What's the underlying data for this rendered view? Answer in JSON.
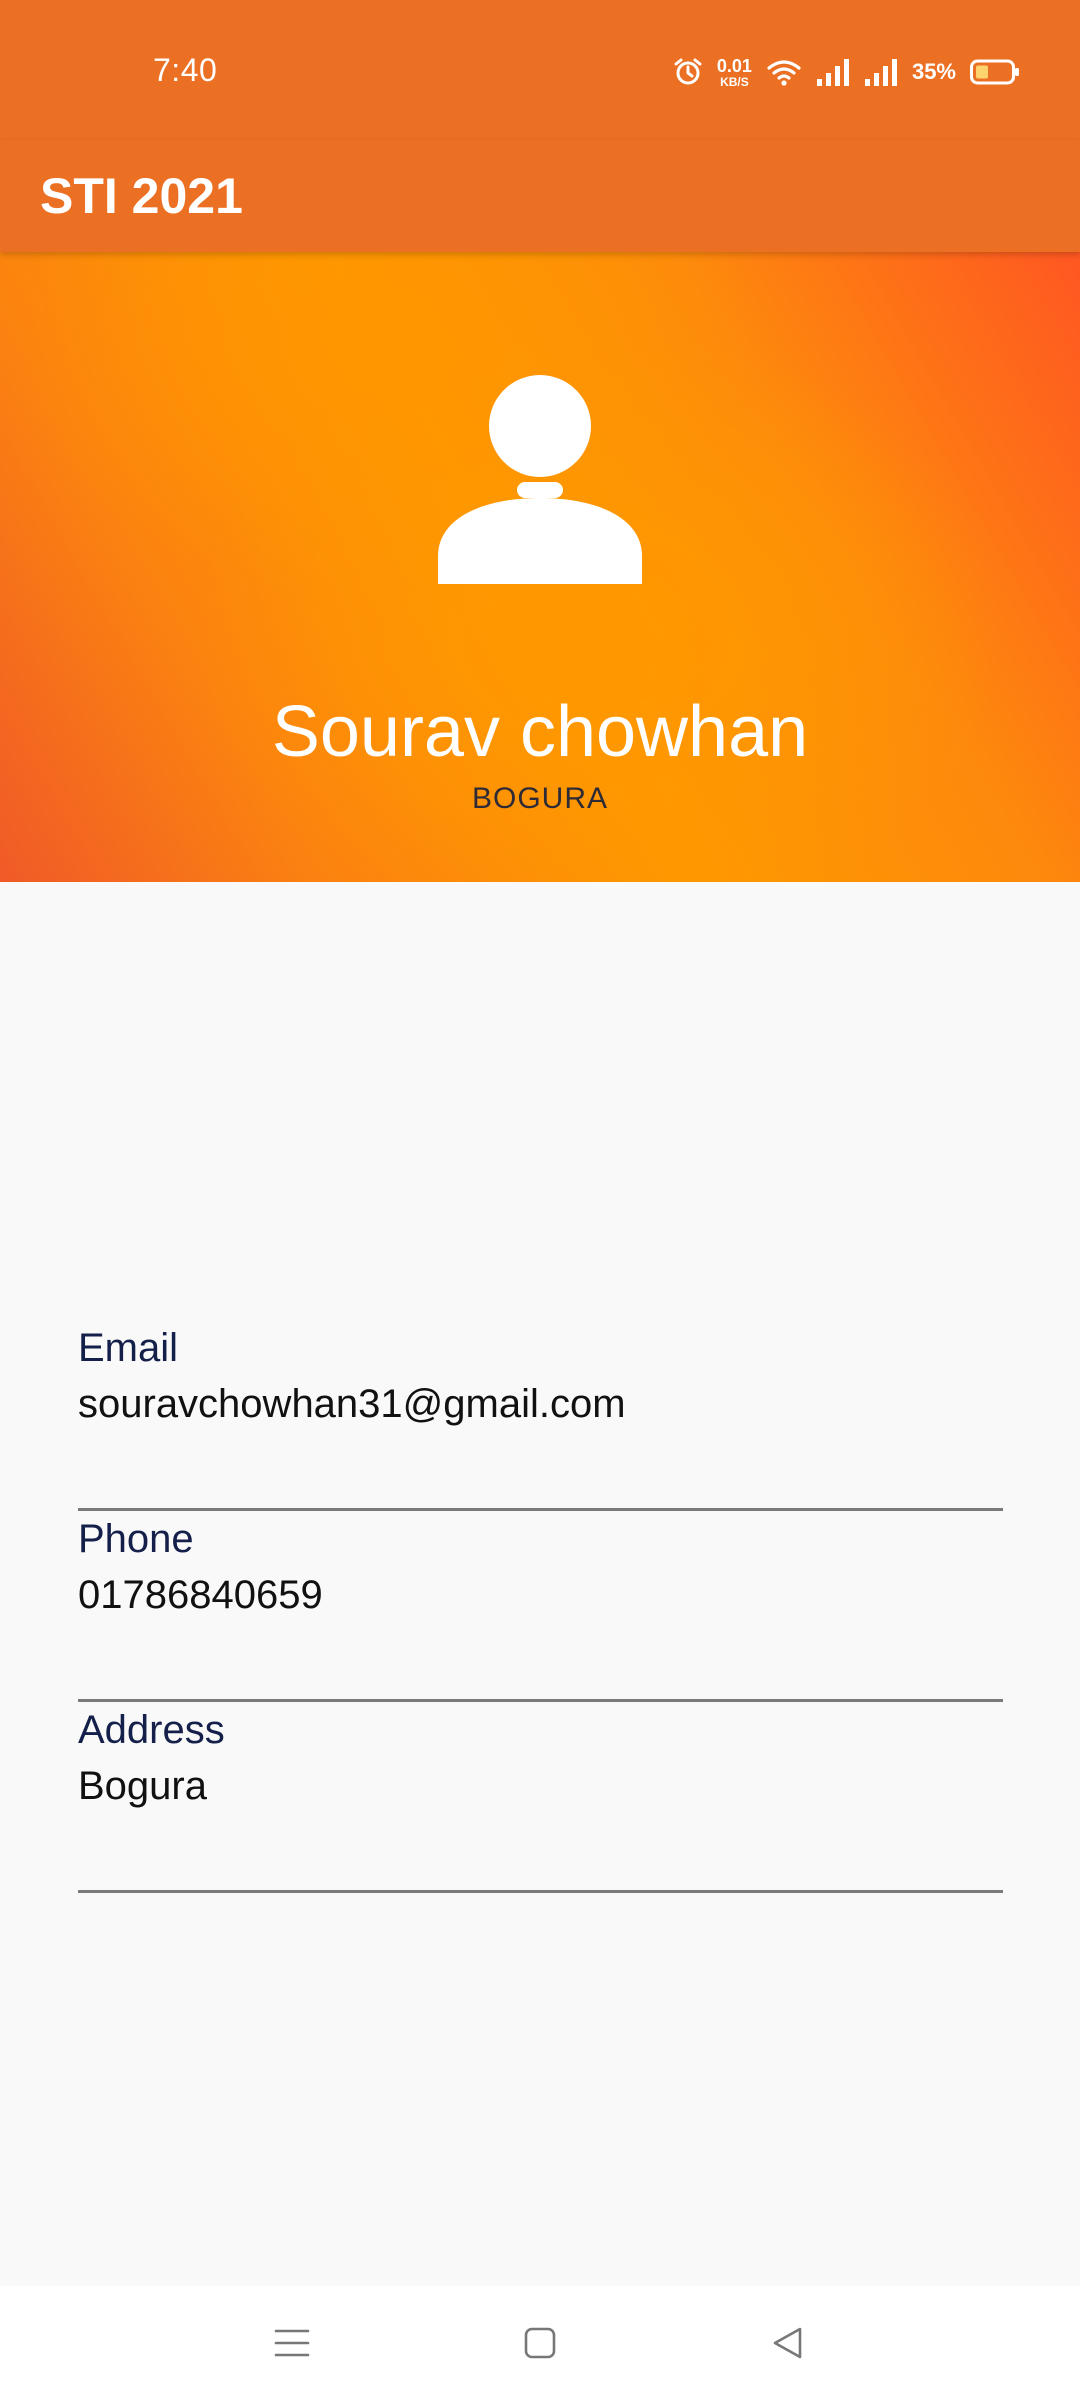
{
  "status_bar": {
    "time": "7:40",
    "net_speed_value": "0.01",
    "net_speed_unit": "KB/S",
    "battery_percent": "35%",
    "icons": [
      "alarm-icon",
      "wifi-icon",
      "signal-icon",
      "signal-icon",
      "battery-icon"
    ]
  },
  "app_bar": {
    "title": "STI 2021"
  },
  "profile": {
    "name": "Sourav chowhan",
    "subtitle": "BOGURA",
    "avatar_icon": "person-icon"
  },
  "fields": [
    {
      "label": "Email",
      "value": "souravchowhan31@gmail.com"
    },
    {
      "label": "Phone",
      "value": "01786840659"
    },
    {
      "label": "Address",
      "value": "Bogura"
    }
  ],
  "nav": {
    "icons": [
      "menu-icon",
      "home-icon",
      "back-icon"
    ]
  },
  "colors": {
    "primary": "#ec7024",
    "header_orange": "#ff9800",
    "header_red": "#ff5722",
    "label_text": "#15204a",
    "background": "#f9f9f9"
  }
}
